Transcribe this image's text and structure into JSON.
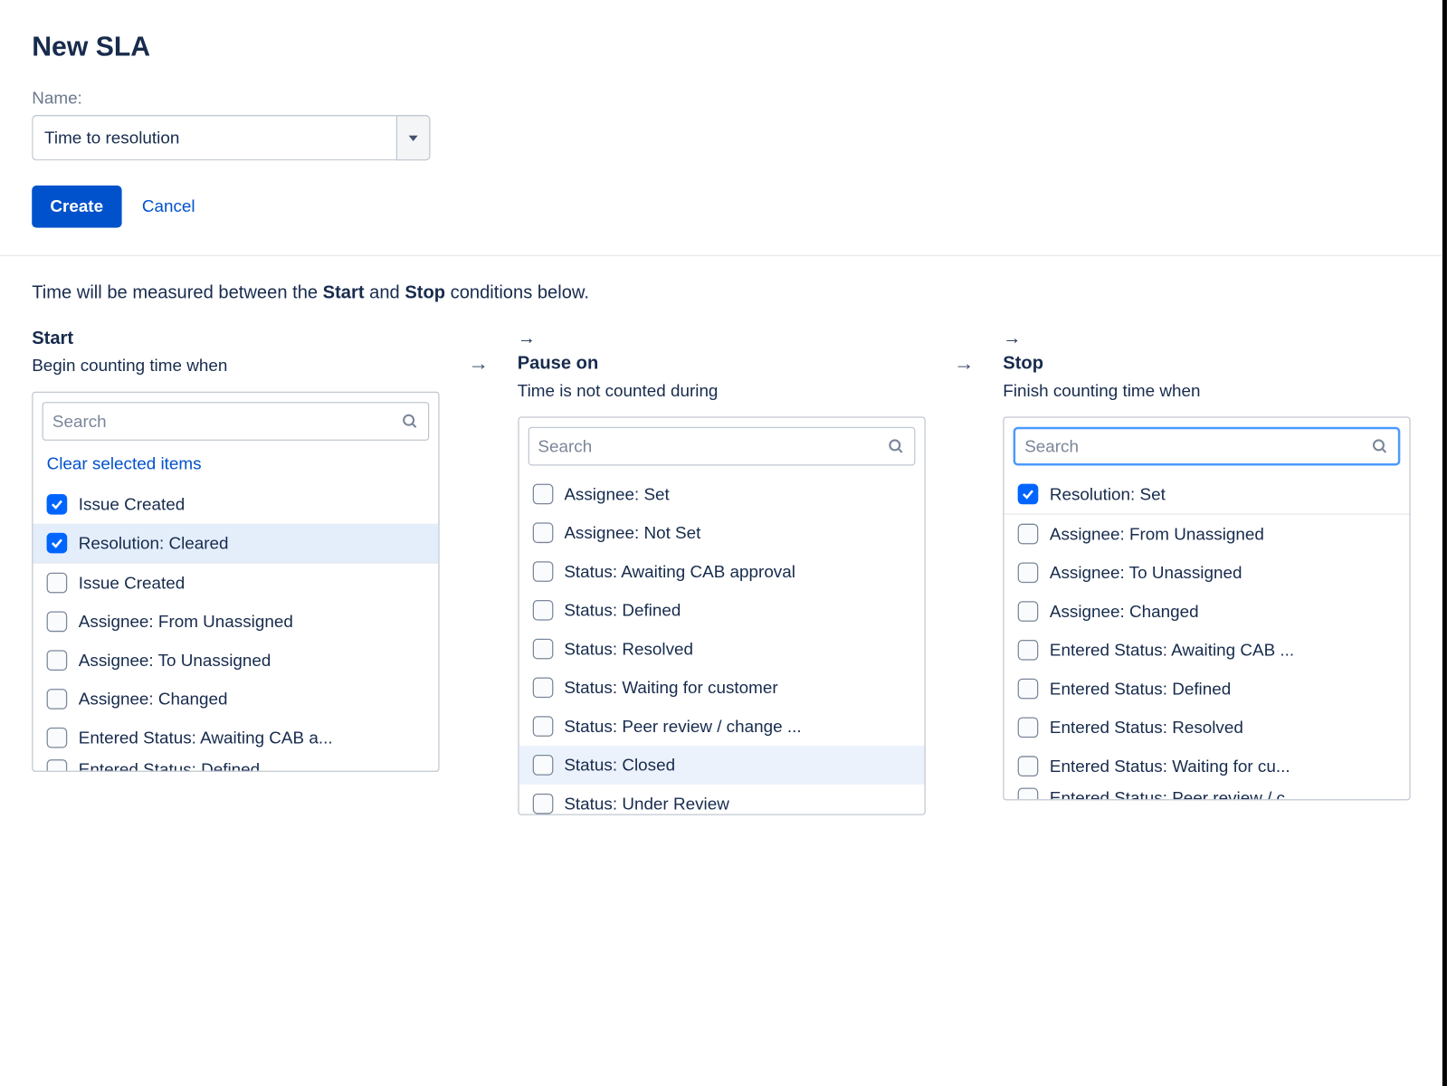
{
  "page_title": "New SLA",
  "name_field": {
    "label": "Name:",
    "value": "Time to resolution"
  },
  "buttons": {
    "create": "Create",
    "cancel": "Cancel"
  },
  "instruction": {
    "prefix": "Time will be measured between the ",
    "start_word": "Start",
    "mid": " and ",
    "stop_word": "Stop",
    "suffix": " conditions below."
  },
  "search_placeholder": "Search",
  "clear_label": "Clear selected items",
  "start": {
    "title": "Start",
    "subtitle": "Begin counting time when",
    "selected": [
      {
        "label": "Issue Created",
        "checked": true,
        "highlight": false
      },
      {
        "label": "Resolution: Cleared",
        "checked": true,
        "highlight": true
      }
    ],
    "options": [
      {
        "label": "Issue Created"
      },
      {
        "label": "Assignee: From Unassigned"
      },
      {
        "label": "Assignee: To Unassigned"
      },
      {
        "label": "Assignee: Changed"
      },
      {
        "label": "Entered Status: Awaiting CAB a..."
      }
    ],
    "cutoff": "Entered Status: Defined"
  },
  "pause": {
    "title": "Pause on",
    "subtitle": "Time is not counted during",
    "options": [
      {
        "label": "Assignee: Set"
      },
      {
        "label": "Assignee: Not Set"
      },
      {
        "label": "Status: Awaiting CAB approval"
      },
      {
        "label": "Status: Defined"
      },
      {
        "label": "Status: Resolved"
      },
      {
        "label": "Status: Waiting for customer"
      },
      {
        "label": "Status: Peer review / change ..."
      },
      {
        "label": "Status: Closed",
        "hover": true
      },
      {
        "label": "Status: Under Review",
        "partial": true
      }
    ]
  },
  "stop": {
    "title": "Stop",
    "subtitle": "Finish counting time when",
    "focused": true,
    "selected": [
      {
        "label": "Resolution: Set",
        "checked": true
      }
    ],
    "options": [
      {
        "label": "Assignee: From Unassigned"
      },
      {
        "label": "Assignee: To Unassigned"
      },
      {
        "label": "Assignee: Changed"
      },
      {
        "label": "Entered Status: Awaiting CAB ..."
      },
      {
        "label": "Entered Status: Defined"
      },
      {
        "label": "Entered Status: Resolved"
      },
      {
        "label": "Entered Status: Waiting for cu..."
      }
    ],
    "cutoff": "Entered Status: Peer review / c..."
  }
}
